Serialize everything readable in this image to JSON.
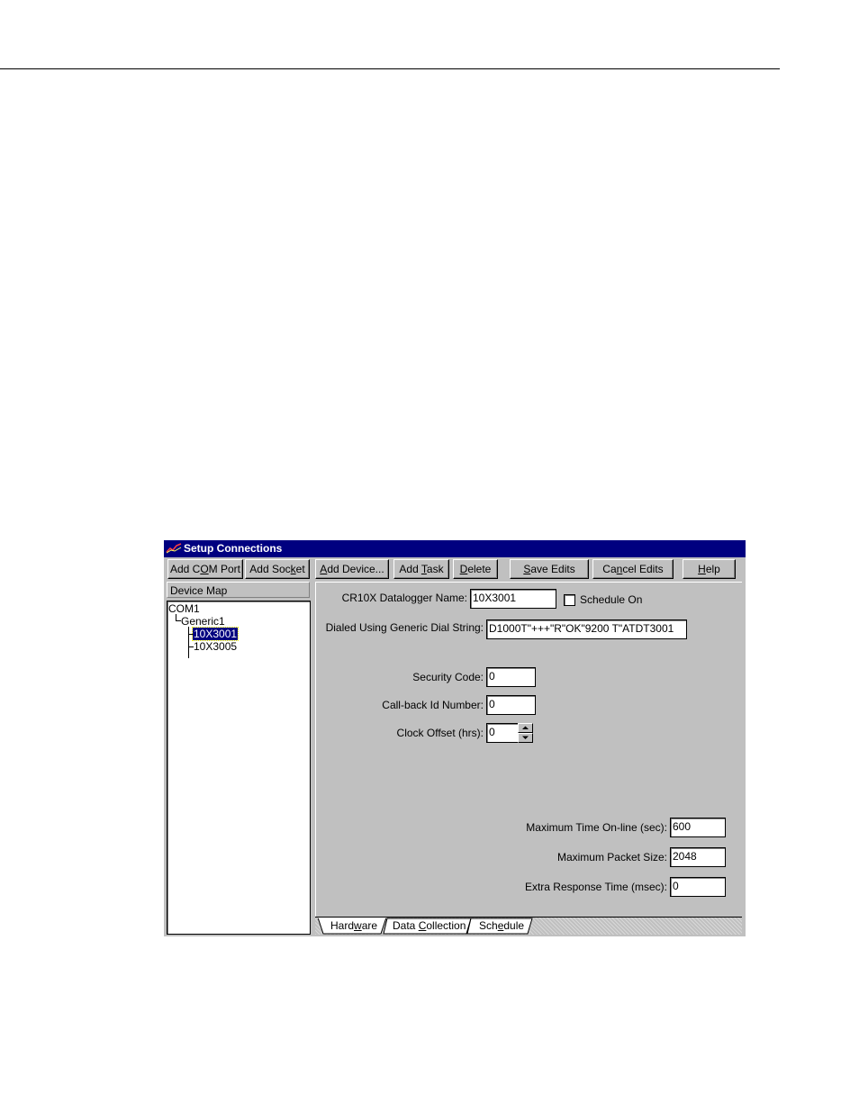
{
  "window": {
    "title": "Setup Connections"
  },
  "toolbar": {
    "add_com_port": [
      "Add C",
      "O",
      "M Port"
    ],
    "add_socket": [
      "Add Soc",
      "k",
      "et"
    ],
    "add_device": [
      "",
      "A",
      "dd Device..."
    ],
    "add_task": [
      "Add ",
      "T",
      "ask"
    ],
    "delete": [
      "",
      "D",
      "elete"
    ],
    "save_edits": [
      "",
      "S",
      "ave Edits"
    ],
    "cancel_edits": [
      "Ca",
      "n",
      "cel Edits"
    ],
    "help": [
      "",
      "H",
      "elp"
    ]
  },
  "device_map": {
    "label": "Device Map",
    "items": [
      "COM1",
      "Generic1",
      "10X3001",
      "10X3005"
    ],
    "selected": "10X3001"
  },
  "form": {
    "name_label": "CR10X Datalogger Name:",
    "name_value": "10X3001",
    "schedule_label": "Schedule On",
    "schedule_checked": false,
    "dial_label": "Dialed Using Generic Dial String:",
    "dial_value": "D1000T\"+++\"R\"OK\"9200 T\"ATDT3001",
    "security_label": "Security Code:",
    "security_value": "0",
    "callback_label": "Call-back Id Number:",
    "callback_value": "0",
    "clock_label": "Clock Offset (hrs):",
    "clock_value": "0",
    "max_online_label": "Maximum Time On-line (sec):",
    "max_online_value": "600",
    "max_packet_label": "Maximum Packet Size:",
    "max_packet_value": "2048",
    "extra_response_label": "Extra Response Time (msec):",
    "extra_response_value": "0"
  },
  "tabs": {
    "hardware": [
      "Hard",
      "w",
      "are"
    ],
    "data_collection": [
      "Data ",
      "C",
      "ollection"
    ],
    "schedule": [
      "Sch",
      "e",
      "dule"
    ],
    "active": "Hardware"
  }
}
